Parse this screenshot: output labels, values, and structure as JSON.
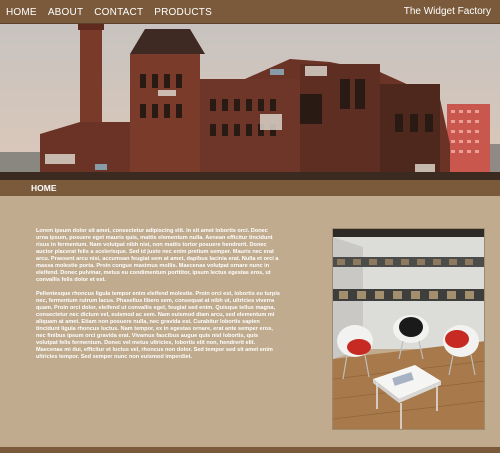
{
  "nav": {
    "items": [
      {
        "label": "HOME"
      },
      {
        "label": "ABOUT"
      },
      {
        "label": "CONTACT"
      },
      {
        "label": "PRODUCTS"
      }
    ]
  },
  "site": {
    "title": "The Widget Factory"
  },
  "section": {
    "title": "HOME"
  },
  "content": {
    "paragraphs": [
      "Lorem ipsum dolor sit amet, consectetur adipiscing elit. In sit amet lobortis orci. Donec urna ipsum, posuere eget mauris quis, mattis elementum nulla. Aenean efficitur tincidunt risus in fermentum. Nam volutpat nibh nisi, non mattis tortor posuere hendrerit. Donec auctor placerat felis a scelerisque. Sed id justo nec enim pretium semper. Mauris nec erat arcu. Praesent arcu nisi, accumsan feugiat sem at amet, dapibus lacinia erat. Nulla et orci a massa molestie porta. Proin congue maximus mollis. Maecenas volutpat ornare nunc in eleifend. Donec pulvinar, metus eu condimentum porttitor, ipsum lectus egestas eros, ut convallis felis dolor et est.",
      "Pellentesque rhoncus ligula tempor enim eleifend molestie. Proin orci est, lobortis eu turpis nec, fermentum rutrum lacus. Phasellus libero sem, consequat at nibh ut, ultricies viverra quam. Proin orci dolor, eleifend ut convallis eget, feugiat sed enim. Quisque tellus magna, consectetur nec dictum vel, euismod ac sem. Nam euismod diam arcu, sed elementum mi aliquam at amet. Etiam non posuere nulla, nec gravida est. Curabitur lobortis sapien tincidunt ligula rhoncus luctus. Nam tempor, ex in egestas ornare, erat ante semper eros, nec finibus ipsum orci gravida erat. Vivamus faucibus augue quis nisl lobortis, quis volutpat felis fermentum. Donec vel metus ultricies, lobortis elit non, hendrerit elit. Maecenas mi dui, efficitur et luctus vel, rhoncus non dolor. Sed tempor sed sit amet enim ultricies tempor. Sed semper nunc non euismod imperdiet."
    ]
  },
  "colors": {
    "bar": "#7a5a3a",
    "background": "#c0ab8e",
    "text": "#ffffff"
  }
}
